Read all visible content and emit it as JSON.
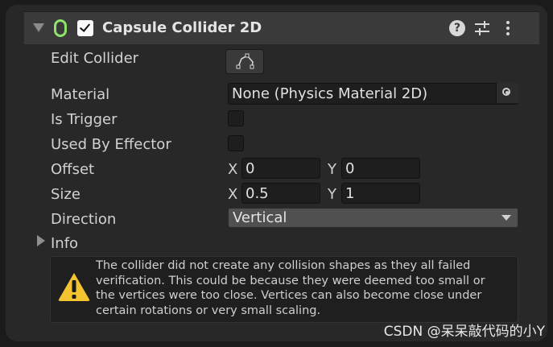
{
  "component": {
    "title": "Capsule Collider 2D",
    "enabled": true,
    "help_icon": "question-mark-icon",
    "presets_icon": "sliders-icon",
    "menu_icon": "kebab-menu-icon"
  },
  "properties": {
    "edit_collider_label": "Edit Collider",
    "material_label": "Material",
    "material_value": "None (Physics Material 2D)",
    "is_trigger_label": "Is Trigger",
    "is_trigger_checked": false,
    "used_by_effector_label": "Used By Effector",
    "used_by_effector_checked": false,
    "offset_label": "Offset",
    "offset_x_label": "X",
    "offset_x": "0",
    "offset_y_label": "Y",
    "offset_y": "0",
    "size_label": "Size",
    "size_x_label": "X",
    "size_x": "0.5",
    "size_y_label": "Y",
    "size_y": "1",
    "direction_label": "Direction",
    "direction_value": "Vertical",
    "info_label": "Info"
  },
  "warning": {
    "lines": [
      "The collider did not create any collision shapes as they all failed",
      "verification.  This could be because they were deemed too small or",
      "the vertices were too close.  Vertices can also become close under",
      "certain rotations or very small scaling."
    ],
    "icon": "warning-triangle-icon",
    "icon_color": "#f4c430"
  },
  "watermark": "CSDN @呆呆敲代码的小Y",
  "colors": {
    "generic_icon": "#8fe36a",
    "header_bg": "#3a3a3a",
    "panel_bg": "#282828"
  }
}
